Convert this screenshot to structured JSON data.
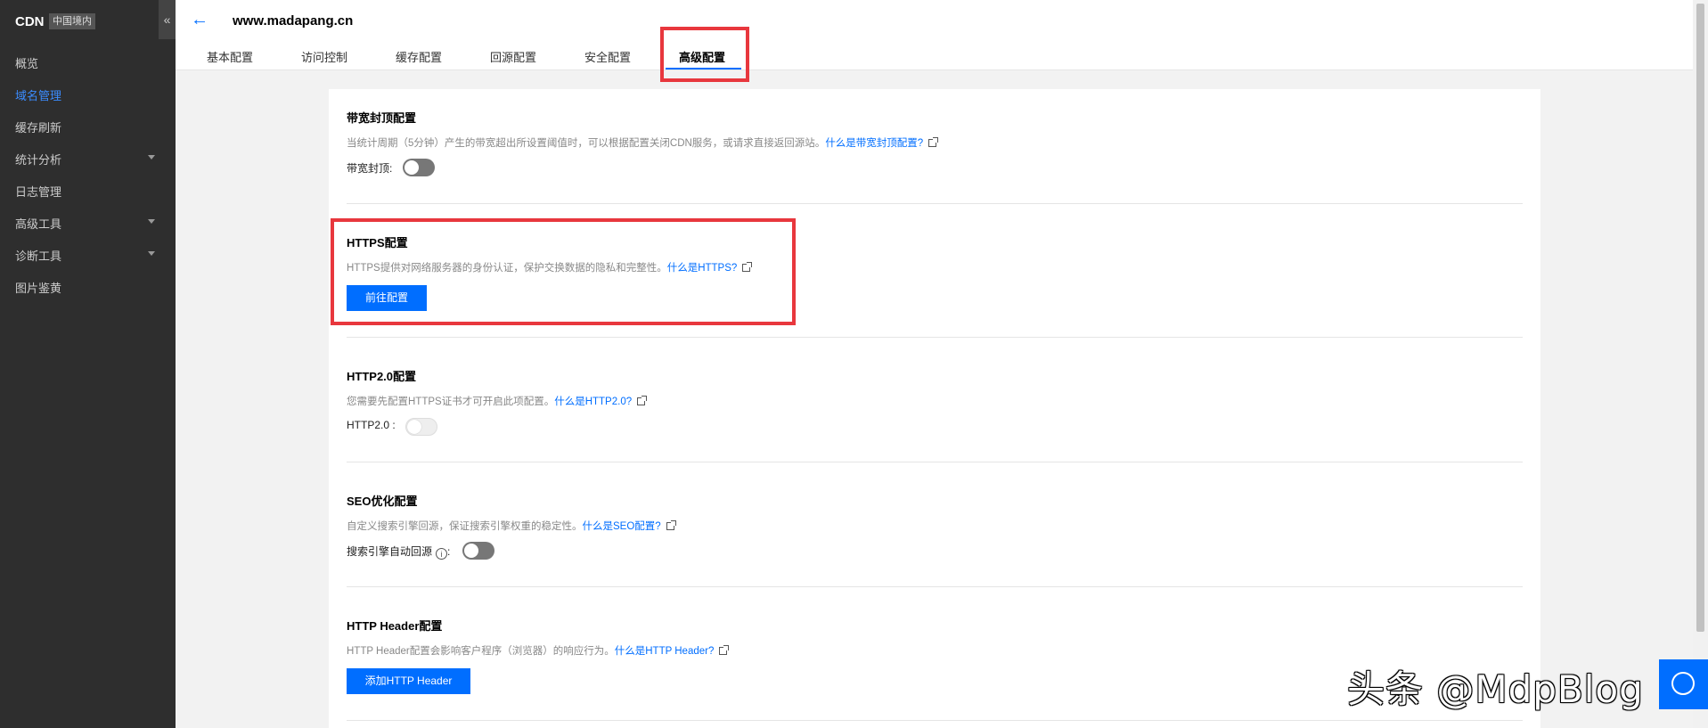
{
  "sidebar": {
    "brand": "CDN",
    "badge": "中国境内",
    "collapse_icon": "«",
    "items": [
      {
        "label": "概览"
      },
      {
        "label": "域名管理",
        "active": true
      },
      {
        "label": "缓存刷新"
      },
      {
        "label": "统计分析",
        "has_submenu": true
      },
      {
        "label": "日志管理"
      },
      {
        "label": "高级工具",
        "has_submenu": true
      },
      {
        "label": "诊断工具",
        "has_submenu": true
      },
      {
        "label": "图片鉴黄"
      }
    ]
  },
  "header": {
    "back_icon": "←",
    "domain": "www.madapang.cn",
    "tabs": [
      {
        "label": "基本配置"
      },
      {
        "label": "访问控制"
      },
      {
        "label": "缓存配置"
      },
      {
        "label": "回源配置"
      },
      {
        "label": "安全配置"
      },
      {
        "label": "高级配置",
        "active": true
      }
    ]
  },
  "sections": {
    "bandwidth": {
      "title": "带宽封顶配置",
      "desc": "当统计周期（5分钟）产生的带宽超出所设置阈值时，可以根据配置关闭CDN服务，或请求直接返回源站。",
      "link": "什么是带宽封顶配置?",
      "field_label": "带宽封顶:",
      "toggle_on": false
    },
    "https": {
      "title": "HTTPS配置",
      "desc": "HTTPS提供对网络服务器的身份认证，保护交换数据的隐私和完整性。",
      "link": "什么是HTTPS?",
      "button": "前往配置"
    },
    "http2": {
      "title": "HTTP2.0配置",
      "desc": "您需要先配置HTTPS证书才可开启此项配置。",
      "link": "什么是HTTP2.0?",
      "field_label": "HTTP2.0 :",
      "toggle_on": false,
      "toggle_disabled": true
    },
    "seo": {
      "title": "SEO优化配置",
      "desc": "自定义搜索引擎回源，保证搜索引擎权重的稳定性。",
      "link": "什么是SEO配置?",
      "field_label": "搜索引擎自动回源",
      "info_icon": "i",
      "colon": ":",
      "toggle_on": false
    },
    "header": {
      "title": "HTTP Header配置",
      "desc": "HTTP Header配置会影响客户程序（浏览器）的响应行为。",
      "link": "什么是HTTP Header?",
      "button": "添加HTTP Header"
    }
  },
  "watermark": "头条 @MdpBlog",
  "colors": {
    "accent": "#006eff",
    "sidebar_bg": "#2e2e2e",
    "highlight_box": "#e8373d"
  }
}
